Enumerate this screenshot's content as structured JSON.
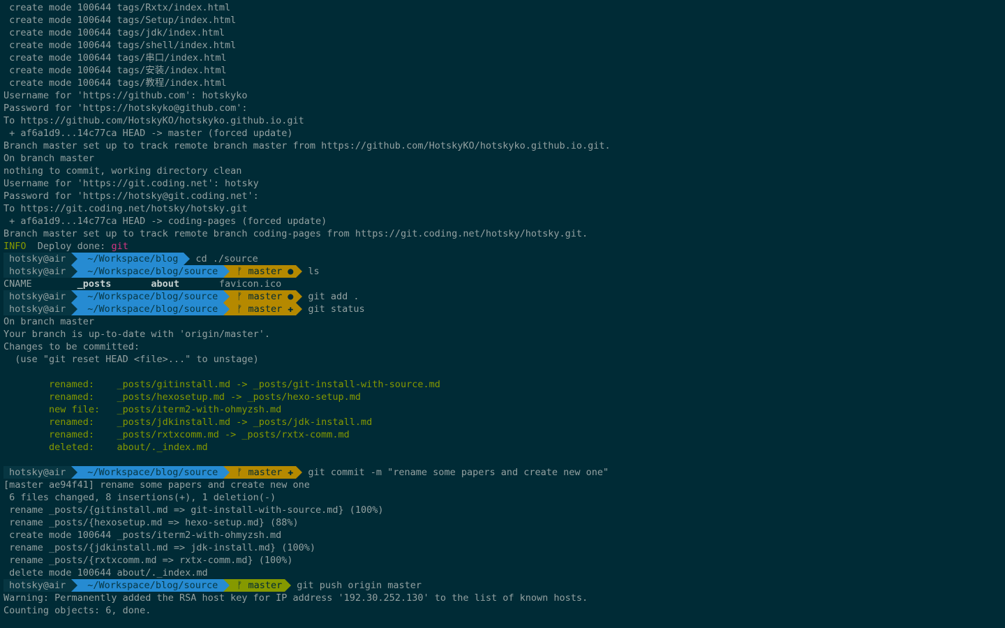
{
  "theme": {
    "background": "#002b36",
    "text": "#93a1a1",
    "green": "#859900",
    "magenta": "#d33682",
    "blue": "#268bd2",
    "yellow": "#b58900",
    "base02": "#073642"
  },
  "lines": [
    {
      "segments": [
        {
          "kind": "plain",
          "text": " create mode 100644 tags/Rxtx/index.html"
        }
      ]
    },
    {
      "segments": [
        {
          "kind": "plain",
          "text": " create mode 100644 tags/Setup/index.html"
        }
      ]
    },
    {
      "segments": [
        {
          "kind": "plain",
          "text": " create mode 100644 tags/jdk/index.html"
        }
      ]
    },
    {
      "segments": [
        {
          "kind": "plain",
          "text": " create mode 100644 tags/shell/index.html"
        }
      ]
    },
    {
      "segments": [
        {
          "kind": "plain",
          "text": " create mode 100644 tags/串口/index.html"
        }
      ]
    },
    {
      "segments": [
        {
          "kind": "plain",
          "text": " create mode 100644 tags/安装/index.html"
        }
      ]
    },
    {
      "segments": [
        {
          "kind": "plain",
          "text": " create mode 100644 tags/教程/index.html"
        }
      ]
    },
    {
      "segments": [
        {
          "kind": "plain",
          "text": "Username for 'https://github.com': hotskyko"
        }
      ]
    },
    {
      "segments": [
        {
          "kind": "plain",
          "text": "Password for 'https://hotskyko@github.com':"
        }
      ]
    },
    {
      "segments": [
        {
          "kind": "plain",
          "text": "To https://github.com/HotskyKO/hotskyko.github.io.git"
        }
      ]
    },
    {
      "segments": [
        {
          "kind": "plain",
          "text": " + af6a1d9...14c77ca HEAD -> master (forced update)"
        }
      ]
    },
    {
      "segments": [
        {
          "kind": "plain",
          "text": "Branch master set up to track remote branch master from https://github.com/HotskyKO/hotskyko.github.io.git."
        }
      ]
    },
    {
      "segments": [
        {
          "kind": "plain",
          "text": "On branch master"
        }
      ]
    },
    {
      "segments": [
        {
          "kind": "plain",
          "text": "nothing to commit, working directory clean"
        }
      ]
    },
    {
      "segments": [
        {
          "kind": "plain",
          "text": "Username for 'https://git.coding.net': hotsky"
        }
      ]
    },
    {
      "segments": [
        {
          "kind": "plain",
          "text": "Password for 'https://hotsky@git.coding.net':"
        }
      ]
    },
    {
      "segments": [
        {
          "kind": "plain",
          "text": "To https://git.coding.net/hotsky/hotsky.git"
        }
      ]
    },
    {
      "segments": [
        {
          "kind": "plain",
          "text": " + af6a1d9...14c77ca HEAD -> coding-pages (forced update)"
        }
      ]
    },
    {
      "segments": [
        {
          "kind": "plain",
          "text": "Branch master set up to track remote branch coding-pages from https://git.coding.net/hotsky/hotsky.git."
        }
      ]
    },
    {
      "segments": [
        {
          "kind": "info",
          "text": "INFO"
        },
        {
          "kind": "plain",
          "text": "  Deploy done: "
        },
        {
          "kind": "git",
          "text": "git"
        }
      ]
    },
    {
      "prompt": {
        "user": "hotsky@air",
        "dir": "~/Workspace/blog",
        "branch": "",
        "status": "",
        "command": "cd ./source"
      }
    },
    {
      "prompt": {
        "user": "hotsky@air",
        "dir": "~/Workspace/blog/source",
        "branch": "master",
        "status": "●",
        "state": "dirty",
        "command": "ls"
      }
    },
    {
      "segments": [
        {
          "kind": "plain",
          "text": "CNAME        "
        },
        {
          "kind": "bold",
          "text": "_posts"
        },
        {
          "kind": "plain",
          "text": "       "
        },
        {
          "kind": "bold",
          "text": "about"
        },
        {
          "kind": "plain",
          "text": "       favicon.ico"
        }
      ]
    },
    {
      "prompt": {
        "user": "hotsky@air",
        "dir": "~/Workspace/blog/source",
        "branch": "master",
        "status": "●",
        "state": "dirty",
        "command": "git add ."
      }
    },
    {
      "prompt": {
        "user": "hotsky@air",
        "dir": "~/Workspace/blog/source",
        "branch": "master",
        "status": "✚",
        "state": "dirty",
        "command": "git status"
      }
    },
    {
      "segments": [
        {
          "kind": "plain",
          "text": "On branch master"
        }
      ]
    },
    {
      "segments": [
        {
          "kind": "plain",
          "text": "Your branch is up-to-date with 'origin/master'."
        }
      ]
    },
    {
      "segments": [
        {
          "kind": "plain",
          "text": "Changes to be committed:"
        }
      ]
    },
    {
      "segments": [
        {
          "kind": "plain",
          "text": "  (use \"git reset HEAD <file>...\" to unstage)"
        }
      ]
    },
    {
      "segments": []
    },
    {
      "segments": [
        {
          "kind": "green",
          "text": "        renamed:    _posts/gitinstall.md -> _posts/git-install-with-source.md"
        }
      ]
    },
    {
      "segments": [
        {
          "kind": "green",
          "text": "        renamed:    _posts/hexosetup.md -> _posts/hexo-setup.md"
        }
      ]
    },
    {
      "segments": [
        {
          "kind": "green",
          "text": "        new file:   _posts/iterm2-with-ohmyzsh.md"
        }
      ]
    },
    {
      "segments": [
        {
          "kind": "green",
          "text": "        renamed:    _posts/jdkinstall.md -> _posts/jdk-install.md"
        }
      ]
    },
    {
      "segments": [
        {
          "kind": "green",
          "text": "        renamed:    _posts/rxtxcomm.md -> _posts/rxtx-comm.md"
        }
      ]
    },
    {
      "segments": [
        {
          "kind": "green",
          "text": "        deleted:    about/._index.md"
        }
      ]
    },
    {
      "segments": []
    },
    {
      "prompt": {
        "user": "hotsky@air",
        "dir": "~/Workspace/blog/source",
        "branch": "master",
        "status": "✚",
        "state": "dirty",
        "command": "git commit -m \"rename some papers and create new one\""
      }
    },
    {
      "segments": [
        {
          "kind": "plain",
          "text": "[master ae94f41] rename some papers and create new one"
        }
      ]
    },
    {
      "segments": [
        {
          "kind": "plain",
          "text": " 6 files changed, 8 insertions(+), 1 deletion(-)"
        }
      ]
    },
    {
      "segments": [
        {
          "kind": "plain",
          "text": " rename _posts/{gitinstall.md => git-install-with-source.md} (100%)"
        }
      ]
    },
    {
      "segments": [
        {
          "kind": "plain",
          "text": " rename _posts/{hexosetup.md => hexo-setup.md} (88%)"
        }
      ]
    },
    {
      "segments": [
        {
          "kind": "plain",
          "text": " create mode 100644 _posts/iterm2-with-ohmyzsh.md"
        }
      ]
    },
    {
      "segments": [
        {
          "kind": "plain",
          "text": " rename _posts/{jdkinstall.md => jdk-install.md} (100%)"
        }
      ]
    },
    {
      "segments": [
        {
          "kind": "plain",
          "text": " rename _posts/{rxtxcomm.md => rxtx-comm.md} (100%)"
        }
      ]
    },
    {
      "segments": [
        {
          "kind": "plain",
          "text": " delete mode 100644 about/._index.md"
        }
      ]
    },
    {
      "prompt": {
        "user": "hotsky@air",
        "dir": "~/Workspace/blog/source",
        "branch": "master",
        "status": "",
        "state": "clean",
        "command": "git push origin master"
      }
    },
    {
      "segments": [
        {
          "kind": "plain",
          "text": "Warning: Permanently added the RSA host key for IP address '192.30.252.130' to the list of known hosts."
        }
      ]
    },
    {
      "segments": [
        {
          "kind": "plain",
          "text": "Counting objects: 6, done."
        }
      ]
    }
  ]
}
